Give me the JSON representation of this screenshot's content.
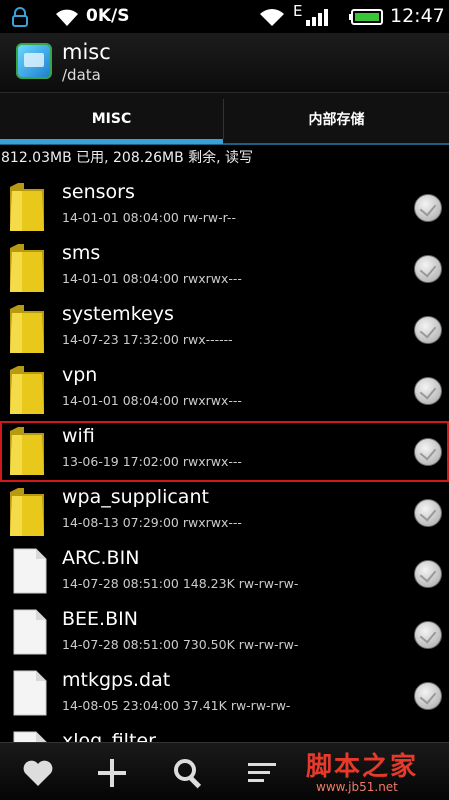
{
  "status_bar": {
    "speed": "0K/S",
    "network_type": "E",
    "time": "12:47",
    "icons": [
      "lock-icon",
      "wifi-icon",
      "wifi-icon",
      "signal-icon",
      "battery-icon"
    ]
  },
  "header": {
    "title": "misc",
    "path": "/data"
  },
  "tabs": [
    {
      "label": "MISC",
      "active": true
    },
    {
      "label": "内部存储",
      "active": false
    }
  ],
  "storage_info": "812.03MB 已用, 208.26MB 剩余, 读写",
  "files": [
    {
      "name": "sensors",
      "date": "14-01-01 08:04:00",
      "size": "",
      "perms": "rw-rw-r--",
      "type": "folder"
    },
    {
      "name": "sms",
      "date": "14-01-01 08:04:00",
      "size": "",
      "perms": "rwxrwx---",
      "type": "folder"
    },
    {
      "name": "systemkeys",
      "date": "14-07-23 17:32:00",
      "size": "",
      "perms": "rwx------",
      "type": "folder"
    },
    {
      "name": "vpn",
      "date": "14-01-01 08:04:00",
      "size": "",
      "perms": "rwxrwx---",
      "type": "folder"
    },
    {
      "name": "wifi",
      "date": "13-06-19 17:02:00",
      "size": "",
      "perms": "rwxrwx---",
      "type": "folder",
      "highlighted": true
    },
    {
      "name": "wpa_supplicant",
      "date": "14-08-13 07:29:00",
      "size": "",
      "perms": "rwxrwx---",
      "type": "folder"
    },
    {
      "name": "ARC.BIN",
      "date": "14-07-28 08:51:00",
      "size": "148.23K",
      "perms": "rw-rw-rw-",
      "type": "file"
    },
    {
      "name": "BEE.BIN",
      "date": "14-07-28 08:51:00",
      "size": "730.50K",
      "perms": "rw-rw-rw-",
      "type": "file"
    },
    {
      "name": "mtkgps.dat",
      "date": "14-08-05 23:04:00",
      "size": "37.41K",
      "perms": "rw-rw-rw-",
      "type": "file"
    },
    {
      "name": "xlog_filter",
      "date": "",
      "size": "",
      "perms": "",
      "type": "file"
    }
  ],
  "bottom_bar": {
    "buttons": [
      "heart-icon",
      "add-icon",
      "search-icon",
      "sort-icon"
    ]
  },
  "watermark": {
    "text": "脚本之家",
    "url": "www.jb51.net"
  },
  "colors": {
    "tab_indicator": "#3aa0d8",
    "highlight_border": "#d01818",
    "folder": "#e8c81a",
    "watermark": "#e83a2a"
  }
}
